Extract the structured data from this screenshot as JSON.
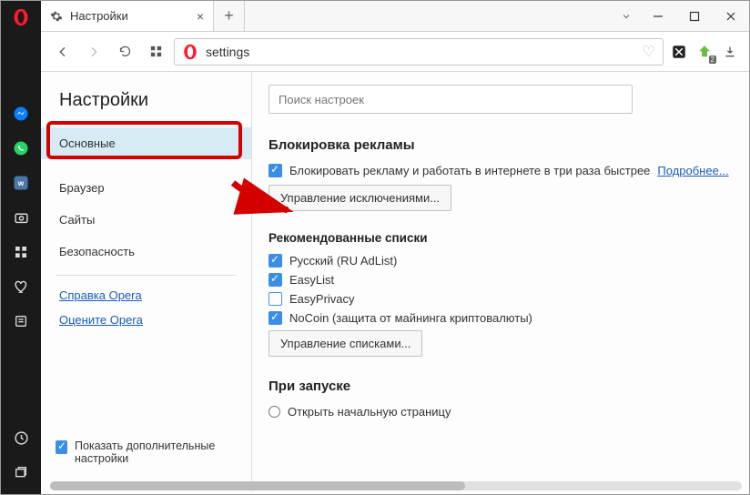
{
  "tab": {
    "title": "Настройки"
  },
  "address": {
    "value": "settings"
  },
  "settings_header": "Настройки",
  "nav": {
    "items": [
      {
        "label": "Основные"
      },
      {
        "label": "Браузер"
      },
      {
        "label": "Сайты"
      },
      {
        "label": "Безопасность"
      }
    ],
    "links": [
      {
        "label": "Справка Opera"
      },
      {
        "label": "Оцените Opera"
      }
    ],
    "show_extra_label": "Показать дополнительные настройки"
  },
  "search": {
    "placeholder": "Поиск настроек"
  },
  "adblock": {
    "title": "Блокировка рекламы",
    "enable_label": "Блокировать рекламу и работать в интернете в три раза быстрее",
    "more_link": "Подробнее...",
    "manage_exceptions": "Управление исключениями...",
    "lists_title": "Рекомендованные списки",
    "lists": [
      {
        "label": "Русский (RU AdList)",
        "checked": true
      },
      {
        "label": "EasyList",
        "checked": true
      },
      {
        "label": "EasyPrivacy",
        "checked": false
      },
      {
        "label": "NoCoin (защита от майнинга криптовалюты)",
        "checked": true
      }
    ],
    "manage_lists": "Управление списками..."
  },
  "startup": {
    "title": "При запуске",
    "options": [
      {
        "label": "Открыть начальную страницу"
      }
    ]
  }
}
